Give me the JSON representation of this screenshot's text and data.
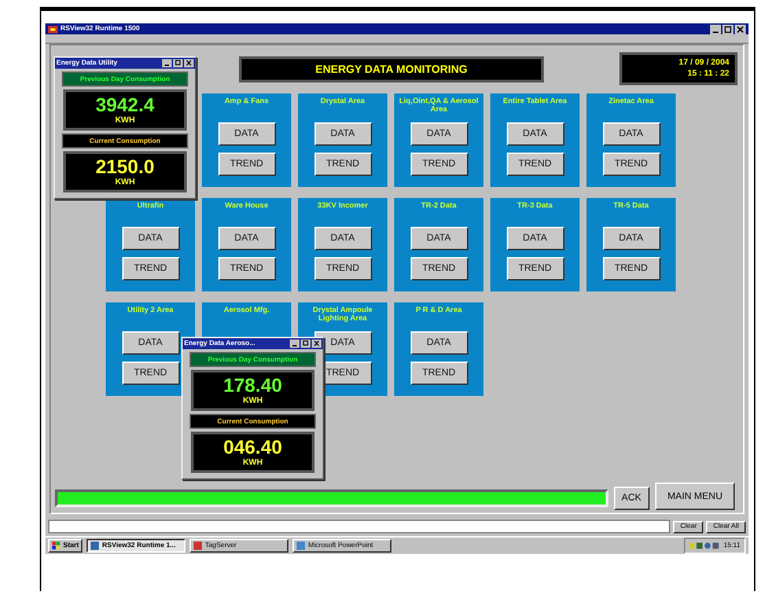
{
  "window": {
    "title": "RSView32 Runtime 1500"
  },
  "header": {
    "title": "ENERGY DATA MONITORING",
    "date": "17 / 09 / 2004",
    "time": "15 : 11 : 22"
  },
  "tile_rows": [
    [
      {
        "kind": "blank"
      },
      {
        "kind": "tile",
        "label": "Amp & Fans",
        "buttons": [
          "DATA",
          "TREND"
        ]
      },
      {
        "kind": "tile",
        "label": "Drystal Area",
        "buttons": [
          "DATA",
          "TREND"
        ]
      },
      {
        "kind": "tile",
        "label": "Liq,Oint,QA & Aerosol Area",
        "buttons": [
          "DATA",
          "TREND"
        ]
      },
      {
        "kind": "tile",
        "label": "Entire Tablet Area",
        "buttons": [
          "DATA",
          "TREND"
        ]
      },
      {
        "kind": "tile",
        "label": "Zinetac Area",
        "buttons": [
          "DATA",
          "TREND"
        ]
      }
    ],
    [
      {
        "kind": "tile",
        "label": "Ultrafin",
        "buttons": [
          "DATA",
          "TREND"
        ]
      },
      {
        "kind": "tile",
        "label": "Ware House",
        "buttons": [
          "DATA",
          "TREND"
        ]
      },
      {
        "kind": "tile",
        "label": "33KV Incomer",
        "buttons": [
          "DATA",
          "TREND"
        ]
      },
      {
        "kind": "tile",
        "label": "TR-2 Data",
        "buttons": [
          "DATA",
          "TREND"
        ]
      },
      {
        "kind": "tile",
        "label": "TR-3 Data",
        "buttons": [
          "DATA",
          "TREND"
        ]
      },
      {
        "kind": "tile",
        "label": "TR-5 Data",
        "buttons": [
          "DATA",
          "TREND"
        ]
      }
    ],
    [
      {
        "kind": "tile",
        "label": "Utility 2 Area",
        "buttons": [
          "DATA",
          "TREND"
        ]
      },
      {
        "kind": "tile",
        "label": "Aerosol Mfg."
      },
      {
        "kind": "tile",
        "label": "Drystal Ampoule Lighting Area",
        "buttons": [
          "DATA",
          "TREND"
        ]
      },
      {
        "kind": "tile",
        "label": "P R & D Area",
        "buttons": [
          "DATA",
          "TREND"
        ]
      }
    ]
  ],
  "popups": [
    {
      "title": "Energy Data Utility",
      "previous_label": "Previous Day Consumption",
      "previous_value": "3942.4",
      "previous_unit": "KWH",
      "current_label": "Current Consumption",
      "current_value": "2150.0",
      "current_unit": "KWH"
    },
    {
      "title": "Energy Data Aeroso...",
      "previous_label": "Previous Day Consumption",
      "previous_value": "178.40",
      "previous_unit": "KWH",
      "current_label": "Current Consumption",
      "current_value": "046.40",
      "current_unit": "KWH"
    }
  ],
  "footer_buttons": [
    "ACK",
    "MAIN MENU"
  ],
  "message_buttons": [
    "Clear",
    "Clear All"
  ],
  "taskbar": {
    "start": "Start",
    "tasks": [
      {
        "label": "RSView32 Runtime 1...",
        "selected": true
      },
      {
        "label": "TagServer",
        "selected": false
      },
      {
        "label": "Microsoft PowerPoint",
        "selected": false
      }
    ],
    "clock": "15:11"
  }
}
